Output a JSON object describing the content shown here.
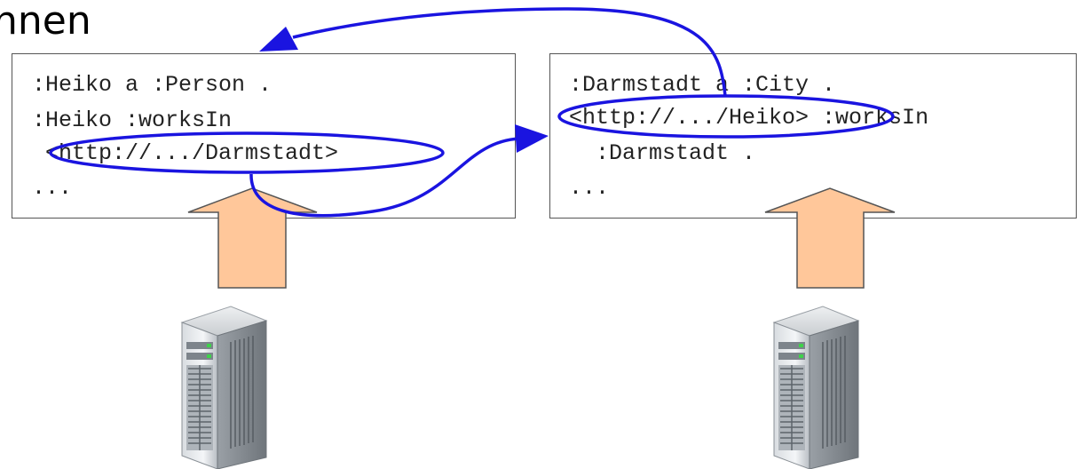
{
  "title": "hnen",
  "left_doc": {
    "lines": [
      ":Heiko a :Person .",
      ":Heiko :worksIn",
      " <http://.../Darmstadt>",
      "..."
    ]
  },
  "right_doc": {
    "lines": [
      ":Darmstadt a :City .",
      "<http://.../Heiko> :worksIn",
      "  :Darmstadt .",
      "..."
    ]
  },
  "colors": {
    "link": "#1a14e0",
    "upload_arrow_fill": "#ffc79a",
    "upload_arrow_stroke": "#555555"
  },
  "icons": [
    "server-icon",
    "server-icon"
  ]
}
